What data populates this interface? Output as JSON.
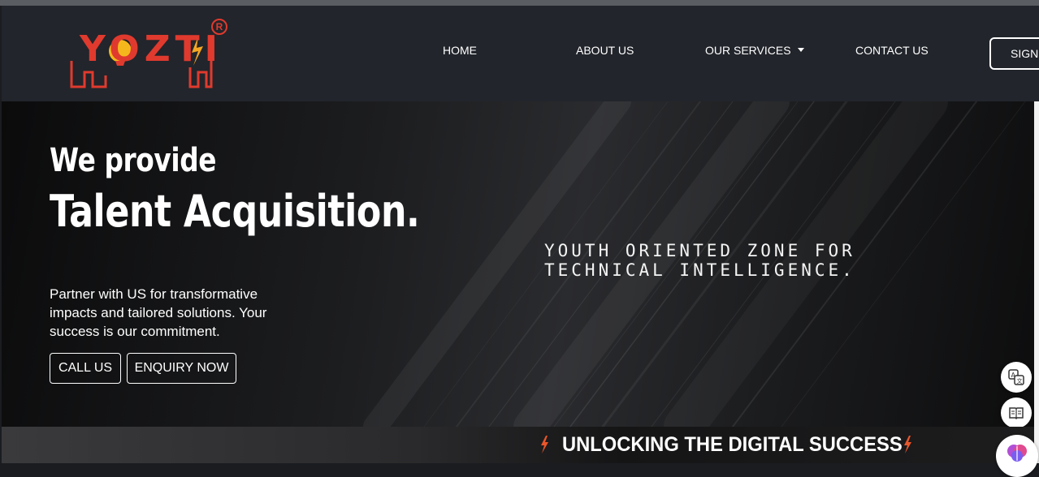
{
  "brand": {
    "name": "YOZTI",
    "registered": "R",
    "color": "#e03a2e"
  },
  "nav": {
    "items": [
      {
        "label": "HOME"
      },
      {
        "label": "ABOUT US"
      },
      {
        "label": "OUR SERVICES"
      },
      {
        "label": "CONTACT US"
      }
    ],
    "sign_label": "SIGN"
  },
  "hero": {
    "line1": "We provide",
    "line2": "Talent Acquisition.",
    "description": "Partner with US for transformative impacts and tailored solutions. Your success is our commitment.",
    "call_label": "CALL US",
    "enquiry_label": "ENQUIRY NOW",
    "tagline": "YOUTH ORIENTED ZONE FOR TECHNICAL INTELLIGENCE."
  },
  "banner": {
    "text": "UNLOCKING THE DIGITAL SUCCESS"
  },
  "side_tools": [
    "translate-icon",
    "reader-icon",
    "brain-icon"
  ]
}
